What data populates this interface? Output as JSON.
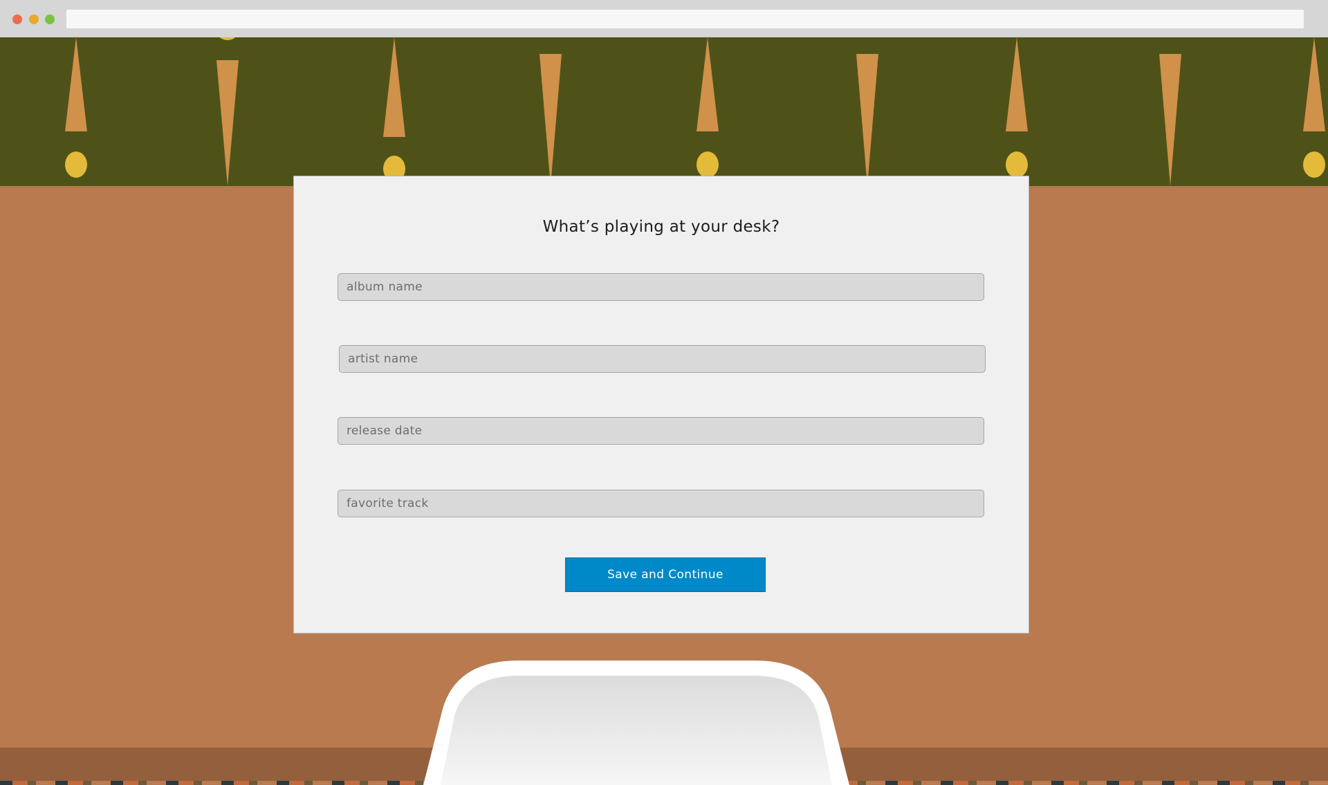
{
  "form": {
    "title": "What’s playing at your desk?",
    "fields": [
      {
        "placeholder": "album name",
        "value": ""
      },
      {
        "placeholder": "artist name",
        "value": ""
      },
      {
        "placeholder": "release date",
        "value": ""
      },
      {
        "placeholder": "favorite track",
        "value": ""
      }
    ],
    "submit_label": "Save and Continue"
  },
  "colors": {
    "wall": "#4e5219",
    "desk": "#b97a50",
    "floor": "#945f3c",
    "card": "#f0f0f0",
    "button": "#0089c8",
    "lamp_shade": "#d0914a",
    "lamp_bulb": "#e3ba3a"
  },
  "icons": {
    "window_close": "close-dot-icon",
    "window_minimize": "minimize-dot-icon",
    "window_maximize": "maximize-dot-icon"
  }
}
